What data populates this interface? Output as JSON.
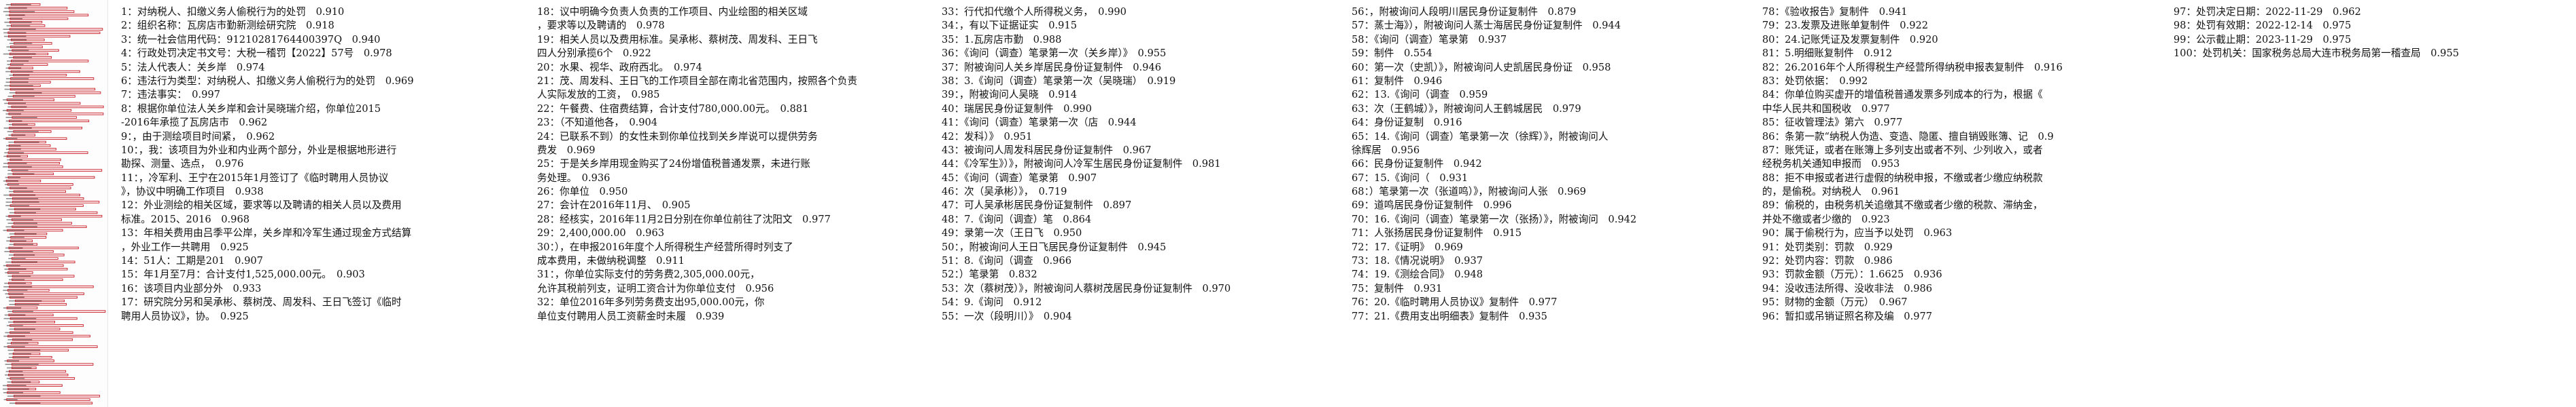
{
  "thumbnail": {
    "label": "document-page-thumbnail",
    "ink_color": "#c8141e",
    "text_color": "#333333"
  },
  "columns": [
    {
      "lines": [
        "1：对纳税人、扣缴义务人偷税行为的处罚　0.910",
        "2：组织名称：瓦房店市勤新测绘研究院　0.918",
        "3：统一社会信用代码：91210281764400397Q　0.940",
        "4：行政处罚决定书文号：大税一稽罚【2022】57号　0.978",
        "5：法人代表人：关乡岸　0.974",
        "6：违法行为类型：对纳税人、扣缴义务人偷税行为的处罚　0.969",
        "7：违法事实：　0.997",
        "8：根据你单位法人关乡岸和会计吴晓瑞介绍，你单位2015",
        "-2016年承揽了瓦房店市　0.962",
        "9：，由于测绘项目时间紧，　0.962",
        "10：，我：该项目为外业和内业两个部分，外业是根据地形进行",
        "勘探、测量、选点，　0.976",
        "11：，冷军利、王宁在2015年1月签订了《临时聘用人员协议",
        "》，协议中明确工作项目　0.938",
        "12：外业测绘的相关区域，要求等以及聘请的相关人员以及费用",
        "标准。2015、2016　0.968",
        "13：年相关费用由吕季平公岸，关乡岸和冷军生通过现金方式结算",
        "，外业工作一共聘用　0.925",
        "14：51人：工期是201　0.907",
        "15：年1月至7月：合计支付1,525,000.00元。　0.903",
        "16：该项目内业部分外　0.933",
        "17：研究院分另和吴承彬、蔡树茂、周发科、王日飞签订《临时",
        "聘用人员协议》，协。　0.925"
      ]
    },
    {
      "lines": [
        "18：议中明确今负责人负责的工作项目、内业绘图的相关区域",
        "，要求等以及聘请的　0.978",
        "19：相关人员以及费用标准。吴承彬、蔡树茂、周发科、王日飞",
        "四人分别承揽6个　0.922",
        "20：水果、视华、政府西北。　0.974",
        "21：茂、周发科、王日飞的工作项目全部在南北省范围内，按照各个负责",
        "人实际发放的工资，　0.985",
        "22：午餐费、住宿费结算，合计支付780,000.00元。　0.881",
        "23：（不知道他各，　0.904",
        "24：已联系不到）的女性未到你单位找到关乡岸说可以提供劳务",
        "费发　0.969",
        "25：于是关乡岸用现金购买了24份增值税普通发票，未进行账",
        "务处理。　0.936",
        "26：你单位　0.950",
        "27：会计在2016年11月、　0.905",
        "28：经核实，2016年11月2日分别在你单位前往了沈阳文　0.977",
        "29：2,400,000.00　0.963",
        "30：），在申报2016年度个人所得税生产经营所得时列支了",
        "成本费用，未做纳税调整　0.911",
        "31：，你单位实际支付的劳务费2,305,000.00元，",
        "允许其税前列支，证明工资合计为你单位支付　0.956",
        "32：单位2016年多列劳务费支出95,000.00元，你",
        "单位支付聘用人员工资薪金时未履　0.939"
      ]
    },
    {
      "lines": [
        "33：行代扣代缴个人所得税义务，　0.990",
        "34：，有以下证据证实　0.915",
        "35：1.瓦房店市勤　0.988",
        "36：《询问（调查）笔录第一次（关乡岸）》　0.955",
        "37：附被询问人关乡岸居民身份证复制件　0.946",
        "38：3.《询问（调查）笔录第一次（吴晓瑞）　0.919",
        "39：，附被询问人吴晓　0.914",
        "40：瑞居民身份证复制件　0.990",
        "41：《询问（调查）笔录第一次（店　0.944",
        "42：发科）》　0.951",
        "43：被询问人周发科居民身份证复制件　0.967",
        "44：《冷军生》）》，附被询问人冷军生居民身份证复制件　0.981",
        "45：《询问（调查）笔录第　0.907",
        "46：次（吴承彬）》，　0.719",
        "47：可人吴承彬居民身份证复制件　0.897",
        "48：7.《询问（调查）笔　0.864",
        "49：录第一次（王日飞　0.950",
        "50：，附被询问人王日飞居民身份证复制件　0.945",
        "51：8.《询问（调查　0.966",
        "52：）笔录第　0.832",
        "53：次（蔡树茂）》，附被询问人蔡树茂居民身份证复制件　0.970",
        "54：9.《询问　0.912",
        "55：一次（段明川）》　0.904"
      ]
    },
    {
      "lines": [
        "56：，附被询问人段明川居民身份证复制件　0.879",
        "57：蒸士海》），附被询问人蒸士海居民身份证复制件　0.944",
        "58：《询问（调查）笔录第　0.937",
        "59：制件　0.554",
        "60：第一次（史凯）》，附被询问人史凯居民身份证　0.958",
        "61：复制件　0.946",
        "62：13.《询问（调查　0.959",
        "63：次（王鹤城）》，附被询问人王鹤城居民　0.979",
        "64：身份证复制　0.916",
        "65：14.《询问（调查）笔录第一次（徐辉）》，附被询问人",
        "徐辉居　0.956",
        "66：民身份证复制件　0.942",
        "67：15.《询问（　0.931",
        "68：）笔录第一次（张道鸣）》，附被询问人张　0.969",
        "69：道鸣居民身份证复制件　0.996",
        "70：16.《询问（调查）笔录第一次（张扬）》，附被询问　0.942",
        "71：人张扬居民身份证复制件　0.915",
        "72：17.《证明》　0.969",
        "73：18.《情况说明》　0.937",
        "74：19.《测绘合同》　0.948",
        "75：复制件　0.931",
        "76：20.《临时聘用人员协议》复制件　0.977",
        "77：21.《费用支出明细表》复制件　0.935"
      ]
    },
    {
      "lines": [
        "78：《验收报告》复制件　0.941",
        "79：23.发票及进账单复制件　0.922",
        "80：24.记账凭证及发票复制件　0.920",
        "81：5.明细账复制件　0.912",
        "82：26.2016年个人所得税生产经营所得纳税申报表复制件　0.916",
        "83：处罚依据：　0.992",
        "84：你单位购买虚开的增值税普通发票多列成本的行为，根据《",
        "中华人民共和国税收　0.977",
        "85：征收管理法》第六　0.977",
        "86：条第一款“纳税人伪造、变造、隐匿、擅自销毁账簿、记　0.9",
        "87：账凭证，或者在账簿上多列支出或者不列、少列收入，或者",
        "经税务机关通知申报而　0.953",
        "88：拒不申报或者进行虚假的纳税申报，不缴或者少缴应纳税款",
        "的，是偷税。对纳税人　0.961",
        "89：偷税的，由税务机关追缴其不缴或者少缴的税款、滞纳金，",
        "并处不缴或者少缴的　0.923",
        "90：属于偷税行为，应当予以处罚　0.963",
        "91：处罚类别：罚款　0.929",
        "92：处罚内容：罚款　0.986",
        "93：罚款金额（万元）：1.6625　0.936",
        "94：没收违法所得、没收非法　0.986",
        "95：财物的金额（万元）　0.967",
        "96：暂扣或吊销证照名称及编　0.977"
      ]
    },
    {
      "lines": [
        "97：处罚决定日期：2022-11-29　0.962",
        "98：处罚有效期：2022-12-14　0.975",
        "99：公示截止期：2023-11-29　0.975",
        "100：处罚机关：国家税务总局大连市税务局第一稽查局　0.955"
      ]
    }
  ]
}
